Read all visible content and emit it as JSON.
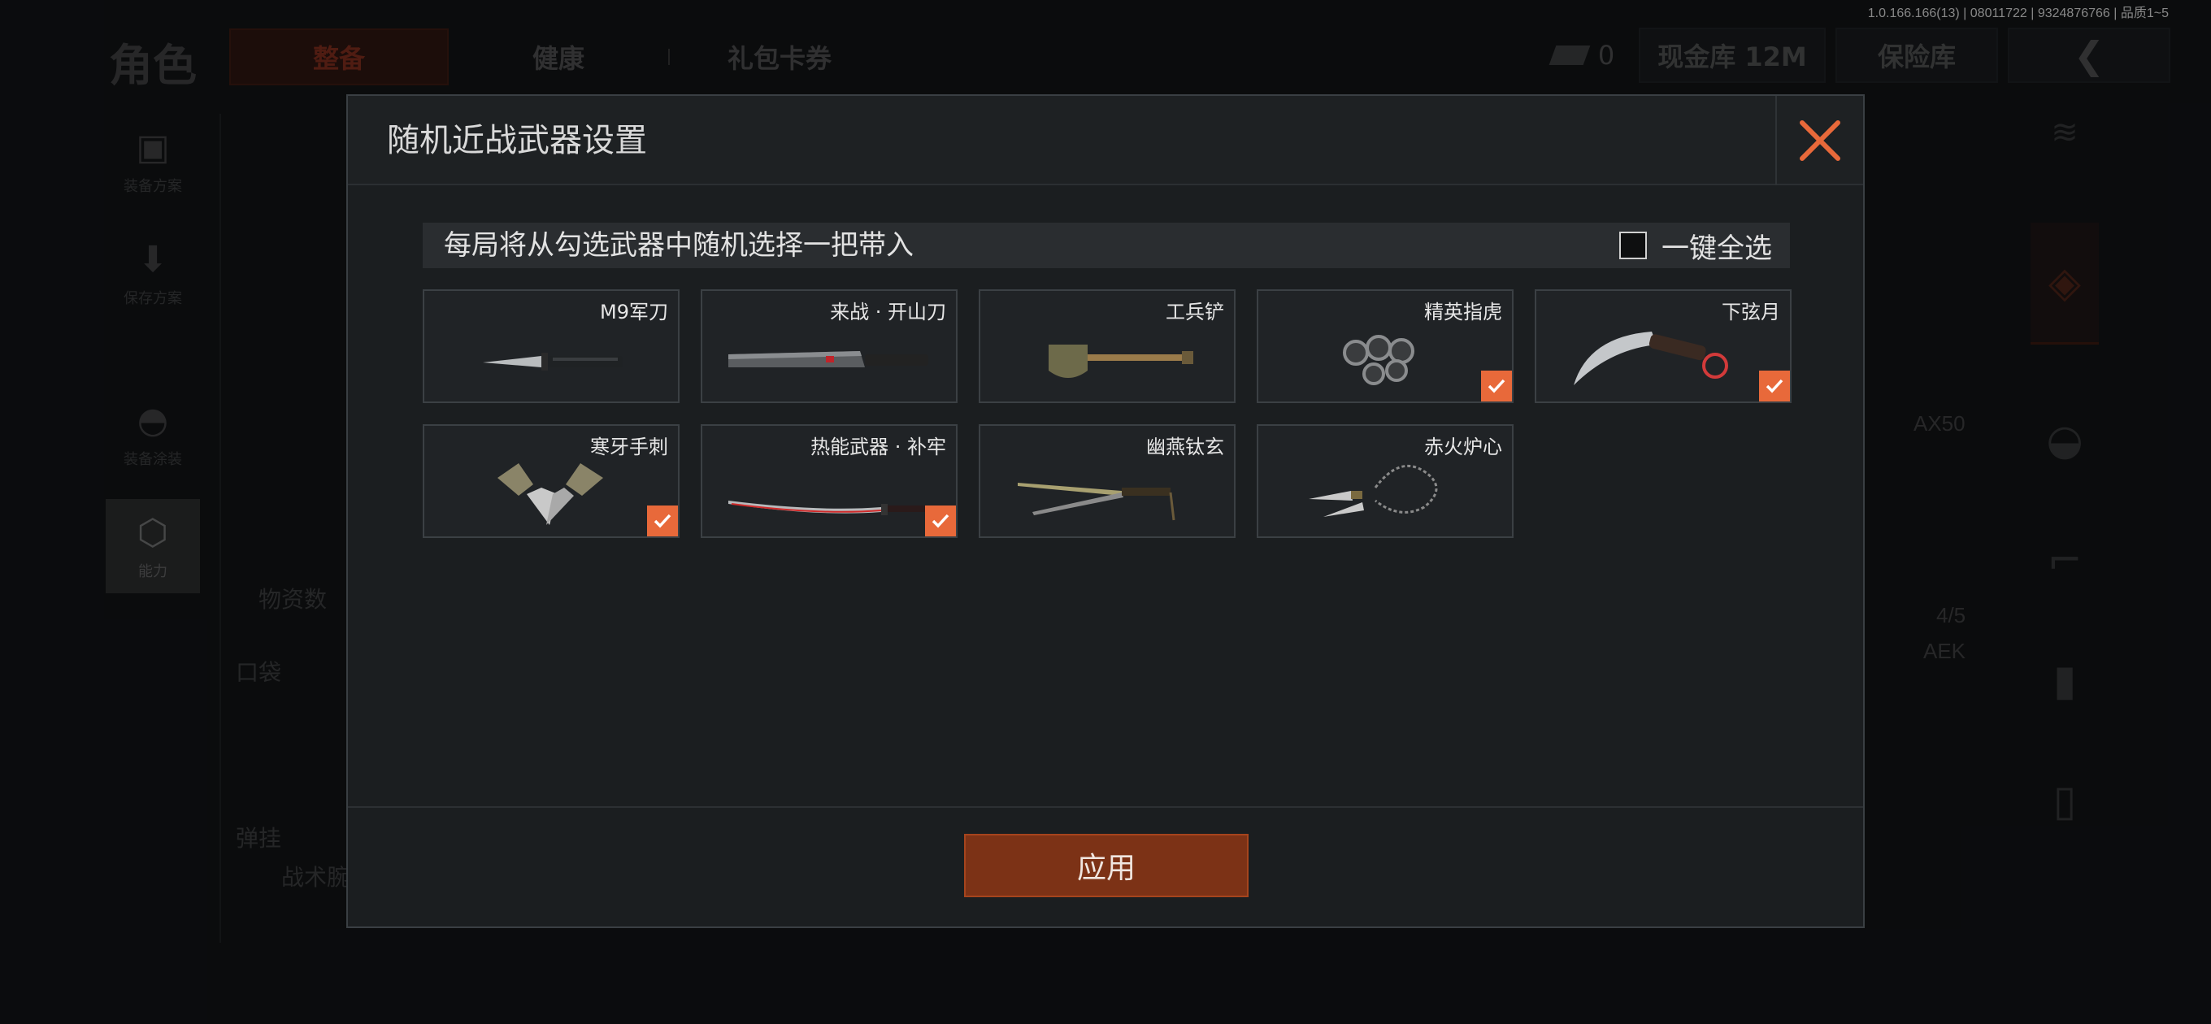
{
  "version_text": "1.0.166.166(13) | 08011722 | 9324876766 | 品质1~5",
  "background": {
    "title": "角色",
    "tabs": [
      "整备",
      "健康",
      "礼包卡券"
    ],
    "top_right": {
      "cash_count": "0",
      "cash_storage": "现金库 12M",
      "safe_box": "保险库"
    },
    "left_nav": [
      {
        "label": "装备方案",
        "icon": "vest-icon"
      },
      {
        "label": "保存方案",
        "icon": "download-icon"
      },
      {
        "label": "装备涂装",
        "icon": "helmet-icon"
      },
      {
        "label": "能力",
        "icon": "ability-icon"
      }
    ],
    "labels": {
      "supplies": "物资数",
      "pocket": "口袋",
      "ammo_rack": "弹挂",
      "tactical": "战术腕",
      "ax50": "AX50",
      "count": "4/5",
      "aek": "AEK"
    }
  },
  "dialog": {
    "title": "随机近战武器设置",
    "info_text": "每局将从勾选武器中随机选择一把带入",
    "select_all_label": "一键全选",
    "select_all_checked": false,
    "apply_label": "应用",
    "accent_color": "#e8693a",
    "weapons": [
      {
        "name": "M9军刀",
        "icon": "bayonet-knife-icon",
        "checked": false
      },
      {
        "name": "来战 · 开山刀",
        "icon": "machete-icon",
        "checked": false
      },
      {
        "name": "工兵铲",
        "icon": "shovel-icon",
        "checked": false
      },
      {
        "name": "精英指虎",
        "icon": "brass-knuckles-icon",
        "checked": true
      },
      {
        "name": "下弦月",
        "icon": "karambit-icon",
        "checked": true
      },
      {
        "name": "寒牙手刺",
        "icon": "push-daggers-icon",
        "checked": true
      },
      {
        "name": "热能武器 · 补牢",
        "icon": "katana-icon",
        "checked": true
      },
      {
        "name": "幽燕钛玄",
        "icon": "swords-icon",
        "checked": false
      },
      {
        "name": "赤火炉心",
        "icon": "rope-darts-icon",
        "checked": false
      }
    ]
  }
}
